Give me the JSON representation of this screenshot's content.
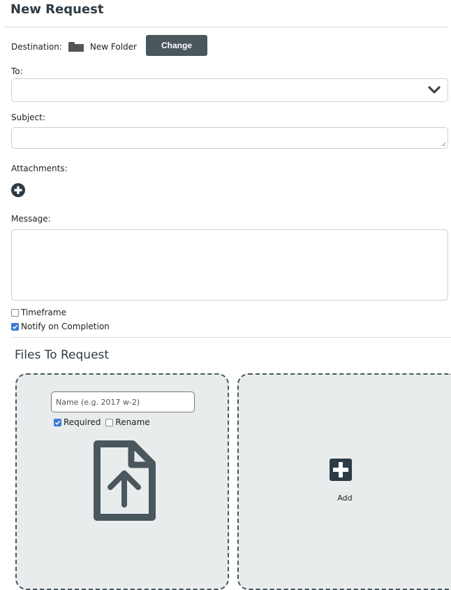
{
  "page": {
    "title": "New Request"
  },
  "destination": {
    "label": "Destination:",
    "folder_name": "New Folder",
    "change_label": "Change"
  },
  "to": {
    "label": "To:",
    "value": ""
  },
  "subject": {
    "label": "Subject:",
    "value": ""
  },
  "attachments": {
    "label": "Attachments:"
  },
  "message": {
    "label": "Message:",
    "value": ""
  },
  "options": {
    "timeframe": {
      "label": "Timeframe",
      "checked": false
    },
    "notify": {
      "label": "Notify on Completion",
      "checked": true
    }
  },
  "files": {
    "title": "Files To Request",
    "item": {
      "name_placeholder": "Name (e.g. 2017 w-2)",
      "required_label": "Required",
      "required_checked": true,
      "rename_label": "Rename",
      "rename_checked": false
    },
    "add_label": "Add"
  },
  "colors": {
    "accent": "#4a575d",
    "check": "#3a7bd5",
    "card_bg": "#e8ecec"
  }
}
